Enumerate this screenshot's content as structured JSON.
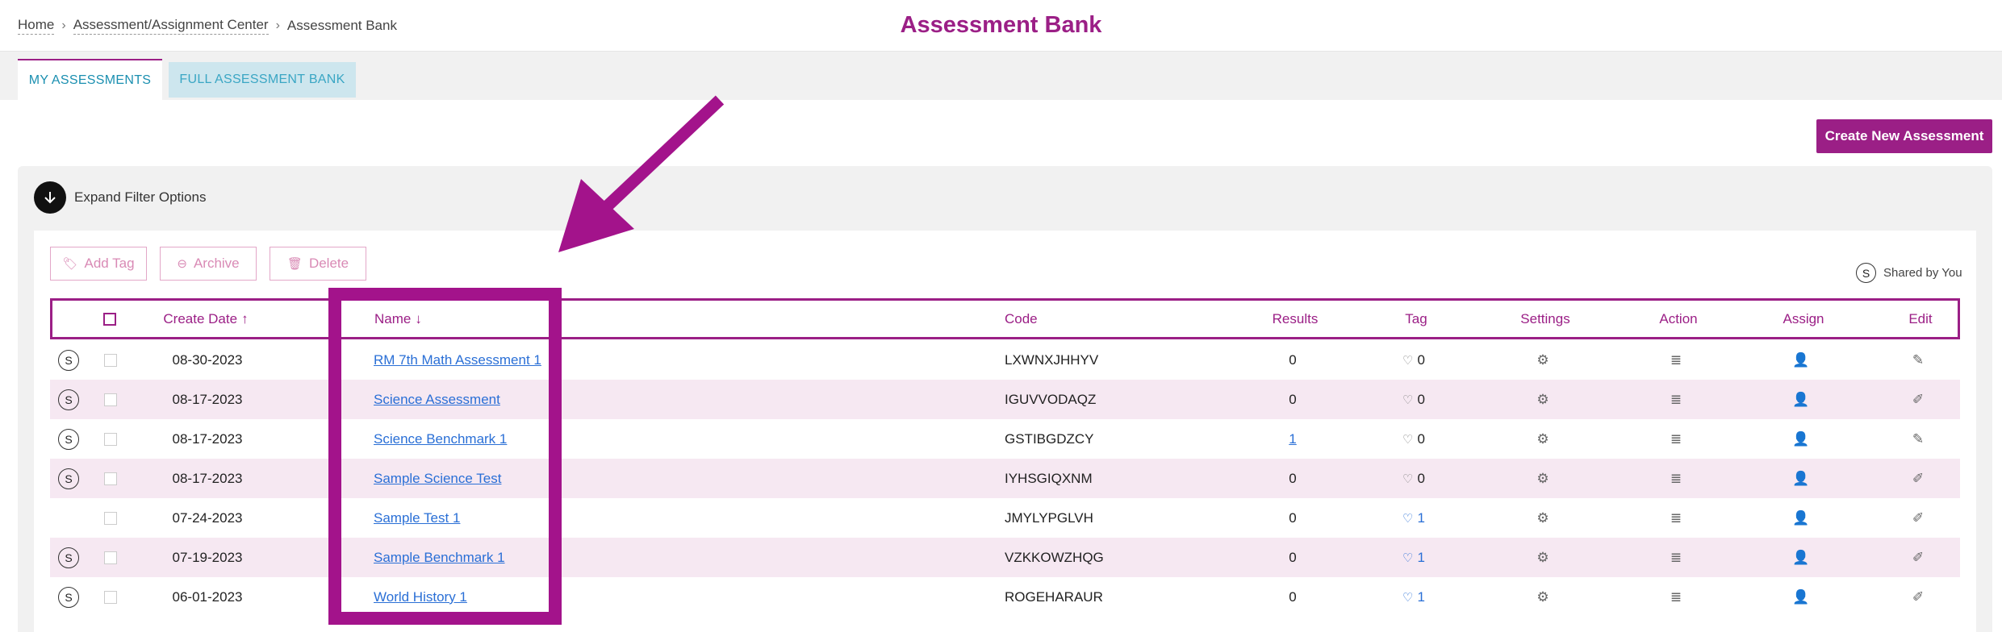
{
  "breadcrumb": {
    "home": "Home",
    "center": "Assessment/Assignment Center",
    "current": "Assessment Bank",
    "separator": "›"
  },
  "page_title": "Assessment Bank",
  "tabs": [
    {
      "label": "MY ASSESSMENTS",
      "active": true
    },
    {
      "label": "FULL ASSESSMENT BANK",
      "active": false
    }
  ],
  "create_button": "Create New Assessment",
  "filters": {
    "expand_label": "Expand Filter Options"
  },
  "actions": {
    "add_tag": "Add Tag",
    "archive": "Archive",
    "delete": "Delete"
  },
  "shared_legend": {
    "badge": "S",
    "label": "Shared by You"
  },
  "table": {
    "headers": {
      "create_date": "Create Date",
      "create_date_sort": "↑",
      "name": "Name",
      "name_sort": "↓",
      "code": "Code",
      "results": "Results",
      "tag": "Tag",
      "settings": "Settings",
      "action": "Action",
      "assign": "Assign",
      "edit": "Edit"
    },
    "rows": [
      {
        "shared": "S",
        "date": "08-30-2023",
        "name": "RM 7th Math Assessment 1",
        "code": "LXWNXJHHYV",
        "results": "0",
        "tag": "0",
        "edit_icon": "pencil-icon"
      },
      {
        "shared": "S",
        "date": "08-17-2023",
        "name": "Science Assessment",
        "code": "IGUVVODAQZ",
        "results": "0",
        "tag": "0",
        "edit_icon": "edit-square-icon"
      },
      {
        "shared": "S",
        "date": "08-17-2023",
        "name": "Science Benchmark 1",
        "code": "GSTIBGDZCY",
        "results": "1",
        "tag": "0",
        "edit_icon": "pencil-icon"
      },
      {
        "shared": "S",
        "date": "08-17-2023",
        "name": "Sample Science Test",
        "code": "IYHSGIQXNM",
        "results": "0",
        "tag": "0",
        "edit_icon": "edit-square-icon"
      },
      {
        "shared": "",
        "date": "07-24-2023",
        "name": "Sample Test 1",
        "code": "JMYLYPGLVH",
        "results": "0",
        "tag": "1",
        "edit_icon": "edit-square-icon"
      },
      {
        "shared": "S",
        "date": "07-19-2023",
        "name": "Sample Benchmark 1",
        "code": "VZKKOWZHQG",
        "results": "0",
        "tag": "1",
        "edit_icon": "edit-square-icon"
      },
      {
        "shared": "S",
        "date": "06-01-2023",
        "name": "World History 1",
        "code": "ROGEHARAUR",
        "results": "0",
        "tag": "1",
        "edit_icon": "edit-square-icon"
      }
    ]
  },
  "colors": {
    "accent": "#9b1f86",
    "link": "#2a6fd6",
    "row_alt": "#f6e8f2",
    "annotation": "#a3138b"
  }
}
